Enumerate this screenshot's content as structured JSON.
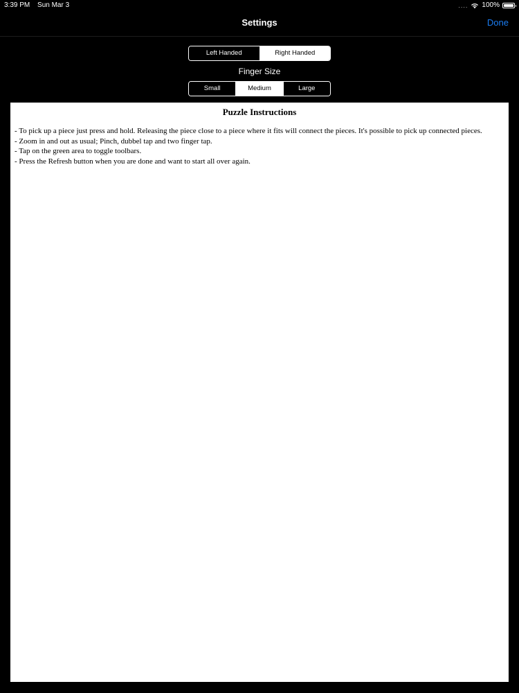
{
  "status_bar": {
    "time": "3:39 PM",
    "date": "Sun Mar 3",
    "signal": "....",
    "battery_text": "100%",
    "battery_level": 1.0
  },
  "nav": {
    "title": "Settings",
    "done_label": "Done",
    "done_color": "#1a7cf2"
  },
  "handedness": {
    "options": [
      "Left Handed",
      "Right Handed"
    ],
    "selected": "Right Handed"
  },
  "finger_size": {
    "label": "Finger Size",
    "options": [
      "Small",
      "Medium",
      "Large"
    ],
    "selected": "Medium"
  },
  "instructions": {
    "title": "Puzzle Instructions",
    "lines": [
      "- To pick up a piece just press and hold. Releasing the piece close to a piece where it fits will connect the pieces. It's possible to pick up connected pieces.",
      "- Zoom in and out as usual; Pinch, dubbel tap and two finger tap.",
      "- Tap on the green area to toggle toolbars.",
      "- Press the Refresh button when you are done and want to start all over again."
    ]
  }
}
